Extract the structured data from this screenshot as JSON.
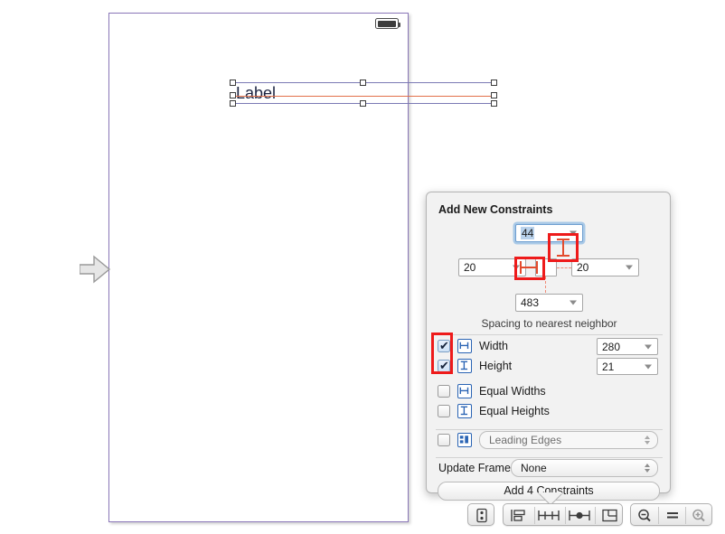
{
  "canvas": {
    "scene_name": "view-controller-scene",
    "status_bar": {
      "battery_icon": "battery-icon"
    },
    "selected_object": {
      "name": "label-object",
      "text": "Label",
      "handles": 8
    },
    "entry_point_icon": "entry-point-arrow-icon"
  },
  "popover": {
    "title": "Add New Constraints",
    "spacing_note": "Spacing to nearest neighbor",
    "spacing": {
      "top": {
        "value": "44",
        "name": "top-spacing"
      },
      "leading": {
        "value": "20",
        "name": "leading-spacing"
      },
      "trailing": {
        "value": "20",
        "name": "trailing-spacing"
      },
      "bottom": {
        "value": "483",
        "name": "bottom-spacing"
      }
    },
    "rows": [
      {
        "key": "width",
        "label": "Width",
        "checked": true,
        "value": "280",
        "icon": "width-constraint-icon"
      },
      {
        "key": "height",
        "label": "Height",
        "checked": true,
        "value": "21",
        "icon": "height-constraint-icon"
      },
      {
        "key": "equal_widths",
        "label": "Equal Widths",
        "checked": false,
        "icon": "equal-widths-icon"
      },
      {
        "key": "equal_heights",
        "label": "Equal Heights",
        "checked": false,
        "icon": "equal-heights-icon"
      }
    ],
    "align": {
      "label": "Align",
      "checked": false,
      "selected_option": "Leading Edges",
      "icon": "align-icon",
      "enabled": false
    },
    "update_frames": {
      "label": "Update Frames",
      "selected_option": "None"
    },
    "add_button": {
      "label": "Add 4 Constraints"
    },
    "highlights": {
      "color": "#ee1b1b",
      "regions": [
        "top-spacing-strut",
        "leading-spacing-strut",
        "width-height-checkboxes"
      ]
    }
  },
  "toolbar": {
    "document_outline": {
      "icon": "document-outline-icon"
    },
    "align_group": [
      {
        "icon": "align-icon",
        "name": "align-button"
      },
      {
        "icon": "pin-icon",
        "name": "pin-button"
      },
      {
        "icon": "resolve-auto-layout-icon",
        "name": "resolve-issues-button"
      },
      {
        "icon": "resizing-behavior-icon",
        "name": "resizing-behavior-button"
      }
    ],
    "zoom_group": [
      {
        "icon": "zoom-out-icon",
        "name": "zoom-out-button"
      },
      {
        "icon": "zoom-actual-size-icon",
        "name": "zoom-actual-size-button"
      },
      {
        "icon": "zoom-in-icon",
        "name": "zoom-in-button"
      }
    ]
  },
  "colors": {
    "selection_edge": "#7b7ab5",
    "baseline": "#e2704a",
    "scene_border": "#8a77b8",
    "highlight_red": "#ee1b1b",
    "focus_blue": "#6ea8de",
    "icon_blue": "#2a64b4"
  }
}
